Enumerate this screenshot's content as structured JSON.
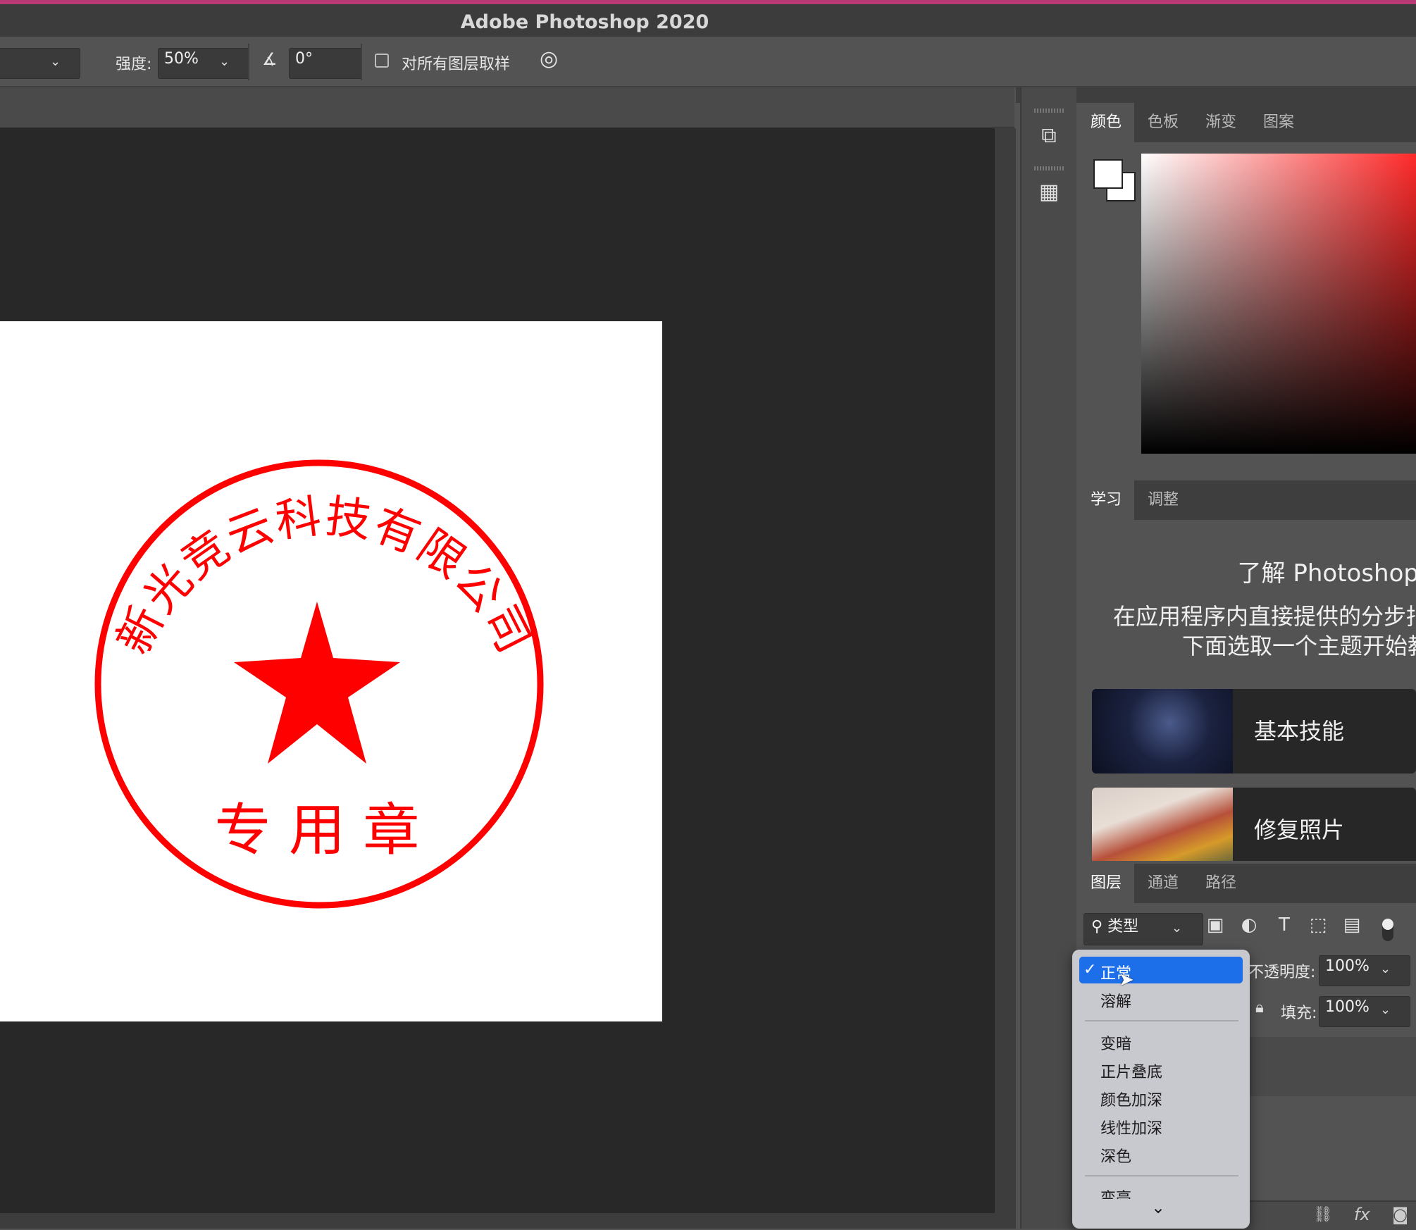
{
  "app": {
    "title": "Adobe Photoshop 2020"
  },
  "options": {
    "strength_label": "强度:",
    "strength_value": "50%",
    "angle_value": "0°",
    "sample_all_label": "对所有图层取样"
  },
  "panels": {
    "color_tabs": [
      "颜色",
      "色板",
      "渐变",
      "图案"
    ],
    "learn_tabs": [
      "学习",
      "调整"
    ],
    "learn": {
      "title": "了解 Photoshop",
      "desc_line1": "在应用程序内直接提供的分步指",
      "desc_line2": "下面选取一个主题开始教",
      "cards": [
        "基本技能",
        "修复照片"
      ]
    },
    "layer_tabs": [
      "图层",
      "通道",
      "路径"
    ],
    "layers": {
      "filter_label": "类型",
      "opacity_label": "不透明度:",
      "opacity_value": "100%",
      "fill_label": "填充:",
      "fill_value": "100%"
    }
  },
  "blend_menu": {
    "check": "✓",
    "selected": "正常",
    "group1": [
      "溶解"
    ],
    "group2": [
      "变暗",
      "正片叠底",
      "颜色加深",
      "线性加深",
      "深色"
    ],
    "partial": "变亮"
  },
  "stamp": {
    "company": "新光竞云科技有限公司",
    "bottom": "专 用 章",
    "color": "#ff0000"
  },
  "colors": {
    "selection": "#1c6fe8",
    "foreground": "#ffffff",
    "background": "#ffffff"
  }
}
